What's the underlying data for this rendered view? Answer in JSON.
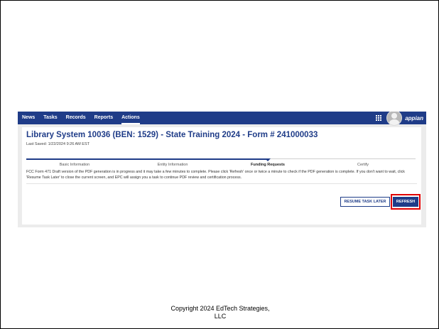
{
  "nav": {
    "items": [
      "News",
      "Tasks",
      "Records",
      "Reports",
      "Actions"
    ],
    "active_item": "Actions",
    "brand": "appian"
  },
  "form": {
    "title": "Library System 10036 (BEN: 1529) - State Training 2024 - Form # 241000033",
    "last_saved": "Last Saved: 1/22/2024 9:26 AM EST",
    "steps": [
      "Basic Information",
      "Entity Information",
      "Funding Requests",
      "Certify"
    ],
    "current_step": "Funding Requests",
    "message": "FCC Form 471 Draft version of the PDF generation is in progress and it may take a few minutes to complete. Please click 'Refresh' once or twice a minute to check if the PDF generation is complete. If you don't want to wait, click 'Resume Task Later' to close the current screen, and EPC will assign you a task to continue PDF review and certification process.",
    "resume_label": "RESUME TASK LATER",
    "refresh_label": "REFRESH"
  },
  "footer": {
    "copyright": "Copyright 2024 EdTech Strategies, LLC"
  },
  "colors": {
    "nav_bg": "#1f3c88",
    "highlight": "#e00000"
  }
}
